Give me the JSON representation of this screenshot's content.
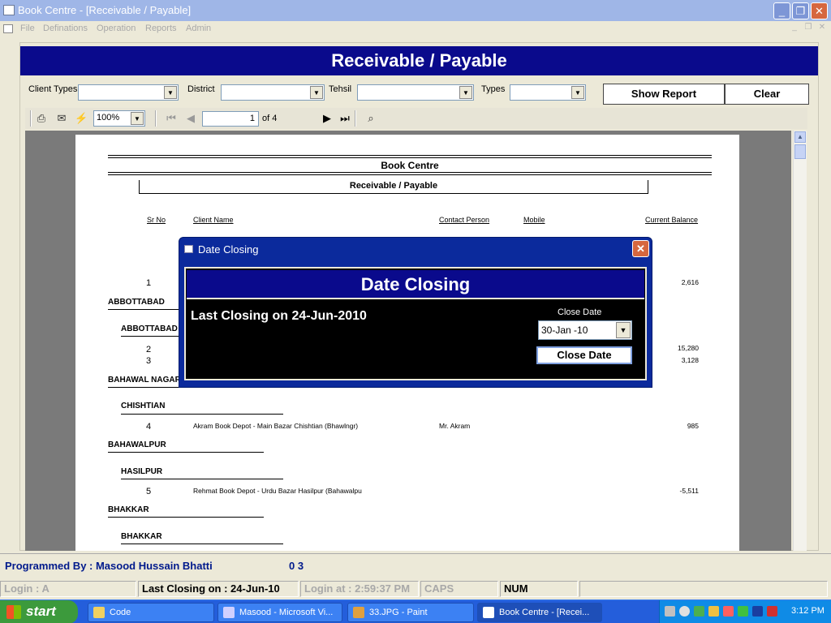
{
  "window": {
    "title": "Book Centre  - [Receivable / Payable]",
    "min_label": "_",
    "max_label": "❐",
    "close_label": "✕"
  },
  "menu": {
    "items": [
      "File",
      "Definations",
      "Operation",
      "Reports",
      "Admin"
    ]
  },
  "form": {
    "header": "Receivable / Payable",
    "filters": {
      "client_types_label": "Client Types",
      "district_label": "District",
      "tehsil_label": "Tehsil",
      "types_label": "Types"
    },
    "show_report_label": "Show Report",
    "clear_label": "Clear"
  },
  "toolbar": {
    "zoom": "100%",
    "page_current": "1",
    "page_of": "of 4"
  },
  "report": {
    "company": "Book Centre",
    "title": "Receivable / Payable",
    "columns": {
      "sr_no": "Sr No",
      "client_name": "Client Name",
      "contact_person": "Contact Person",
      "mobile": "Mobile",
      "current_balance": "Current Balance"
    },
    "rows": [
      {
        "sr": "1",
        "balance": "2,616"
      },
      {
        "sr": "2",
        "balance": "15,280"
      },
      {
        "sr": "3",
        "balance": "3,128"
      },
      {
        "sr": "4",
        "name": "Akram Book Depot - Main Bazar Chishtian (Bhawlngr)",
        "contact": "Mr. Akram",
        "balance": "985"
      },
      {
        "sr": "5",
        "name": "Rehmat Book Depot - Urdu Bazar Hasilpur (Bahawalpu",
        "balance": "-5,511"
      }
    ],
    "groups": {
      "g1": "ABBOTTABAD",
      "g1_sub": "ABBOTTABAD",
      "g2": "BAHAWAL NAGAR",
      "g2_sub": "CHISHTIAN",
      "g3": "BAHAWALPUR",
      "g3_sub": "HASILPUR",
      "g4": "BHAKKAR",
      "g4_sub": "BHAKKAR"
    }
  },
  "dialog": {
    "title": "Date Closing",
    "close_label": "✕",
    "header": "Date Closing",
    "last_closing": "Last Closing on   24-Jun-2010",
    "close_date_label": "Close Date",
    "close_date_value": "30-Jan -10",
    "close_date_button": "Close Date"
  },
  "footer": {
    "programmed_by": "Programmed By : Masood Hussain Bhatti",
    "code": "0 3"
  },
  "status": {
    "login": "Login :  A",
    "last_closing": "Last Closing on : 24-Jun-10",
    "login_at": "Login at : 2:59:37 PM",
    "caps": "CAPS",
    "num": "NUM"
  },
  "taskbar": {
    "start": "start",
    "tasks": [
      "Code",
      "Masood - Microsoft Vi...",
      "33.JPG - Paint",
      "Book Centre  - [Recei..."
    ],
    "clock": "3:12 PM"
  }
}
